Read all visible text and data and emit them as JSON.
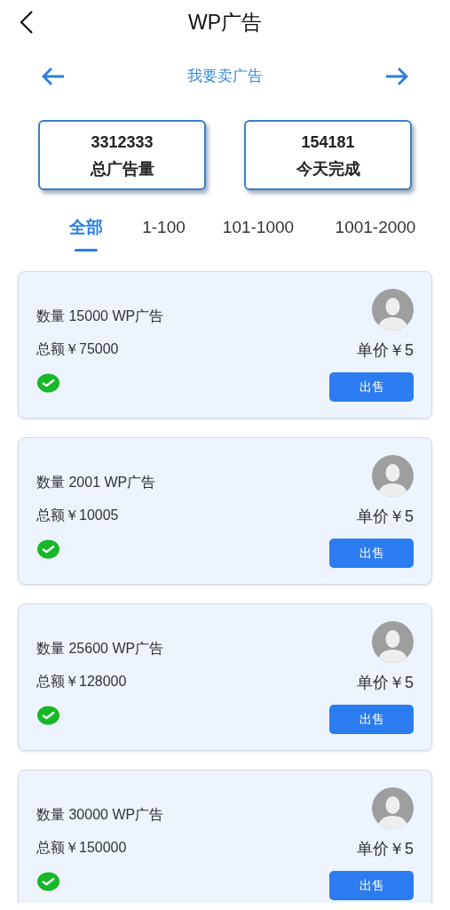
{
  "header": {
    "title": "WP广告"
  },
  "switcher": {
    "label": "我要卖广告"
  },
  "stats": [
    {
      "value": "3312333",
      "label": "总广告量"
    },
    {
      "value": "154181",
      "label": "今天完成"
    }
  ],
  "tabs": [
    {
      "label": "全部",
      "selected": true
    },
    {
      "label": "1-100",
      "selected": false
    },
    {
      "label": "101-1000",
      "selected": false
    },
    {
      "label": "1001-2000",
      "selected": false
    }
  ],
  "listings": [
    {
      "quantity": "数量 15000 WP广告",
      "total": "总额￥75000",
      "price": "单价￥5",
      "action": "出售"
    },
    {
      "quantity": "数量 2001 WP广告",
      "total": "总额￥10005",
      "price": "单价￥5",
      "action": "出售"
    },
    {
      "quantity": "数量 25600 WP广告",
      "total": "总额￥128000",
      "price": "单价￥5",
      "action": "出售"
    },
    {
      "quantity": "数量 30000 WP广告",
      "total": "总额￥150000",
      "price": "单价￥5",
      "action": "出售"
    }
  ]
}
